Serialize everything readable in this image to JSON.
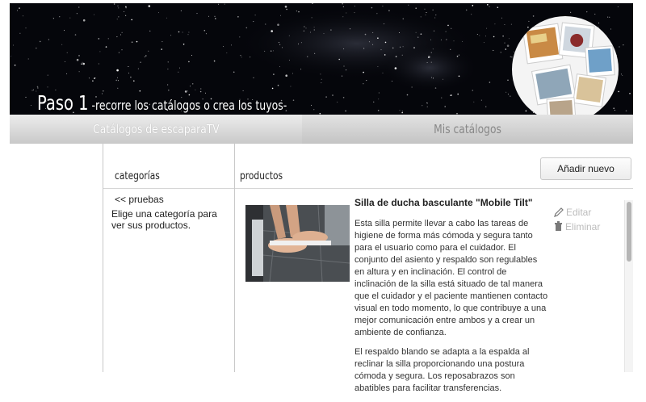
{
  "banner": {
    "step_number": "Paso 1",
    "step_text": "-recorre los catálogos o crea los tuyos-"
  },
  "tabs": [
    {
      "label": "Catálogos de escaparaTV",
      "active": true
    },
    {
      "label": "Mis catálogos",
      "active": false
    }
  ],
  "categories": {
    "heading": "categorías",
    "back_link": "<< pruebas",
    "help_text": "Elige una categoría para ver sus productos."
  },
  "products": {
    "heading": "productos",
    "add_button": "Añadir nuevo",
    "item": {
      "title": "Silla de ducha basculante \"Mobile Tilt\"",
      "paragraphs": [
        "Esta silla permite llevar a cabo las tareas de higiene de forma más cómoda y segura tanto para el usuario como para el cuidador. El conjunto del asiento y respaldo son regulables en altura y en inclinación. El control de inclinación de la silla está situado de tal manera que el cuidador y el paciente mantienen contacto visual en todo momento, lo que contribuye a una mejor comunicación entre ambos y a crear un ambiente de confianza.",
        "El respaldo blando se adapta a la espalda al reclinar la silla proporcionando una postura cómoda y segura. Los reposabrazos son abatibles para facilitar transferencias."
      ],
      "edit_label": "Editar",
      "delete_label": "Eliminar"
    }
  },
  "colors": {
    "banner_bg": "#05060b",
    "tab_active_text": "#ffffff",
    "tab_inactive_text": "#888888",
    "action_disabled": "#bcbcbc"
  }
}
